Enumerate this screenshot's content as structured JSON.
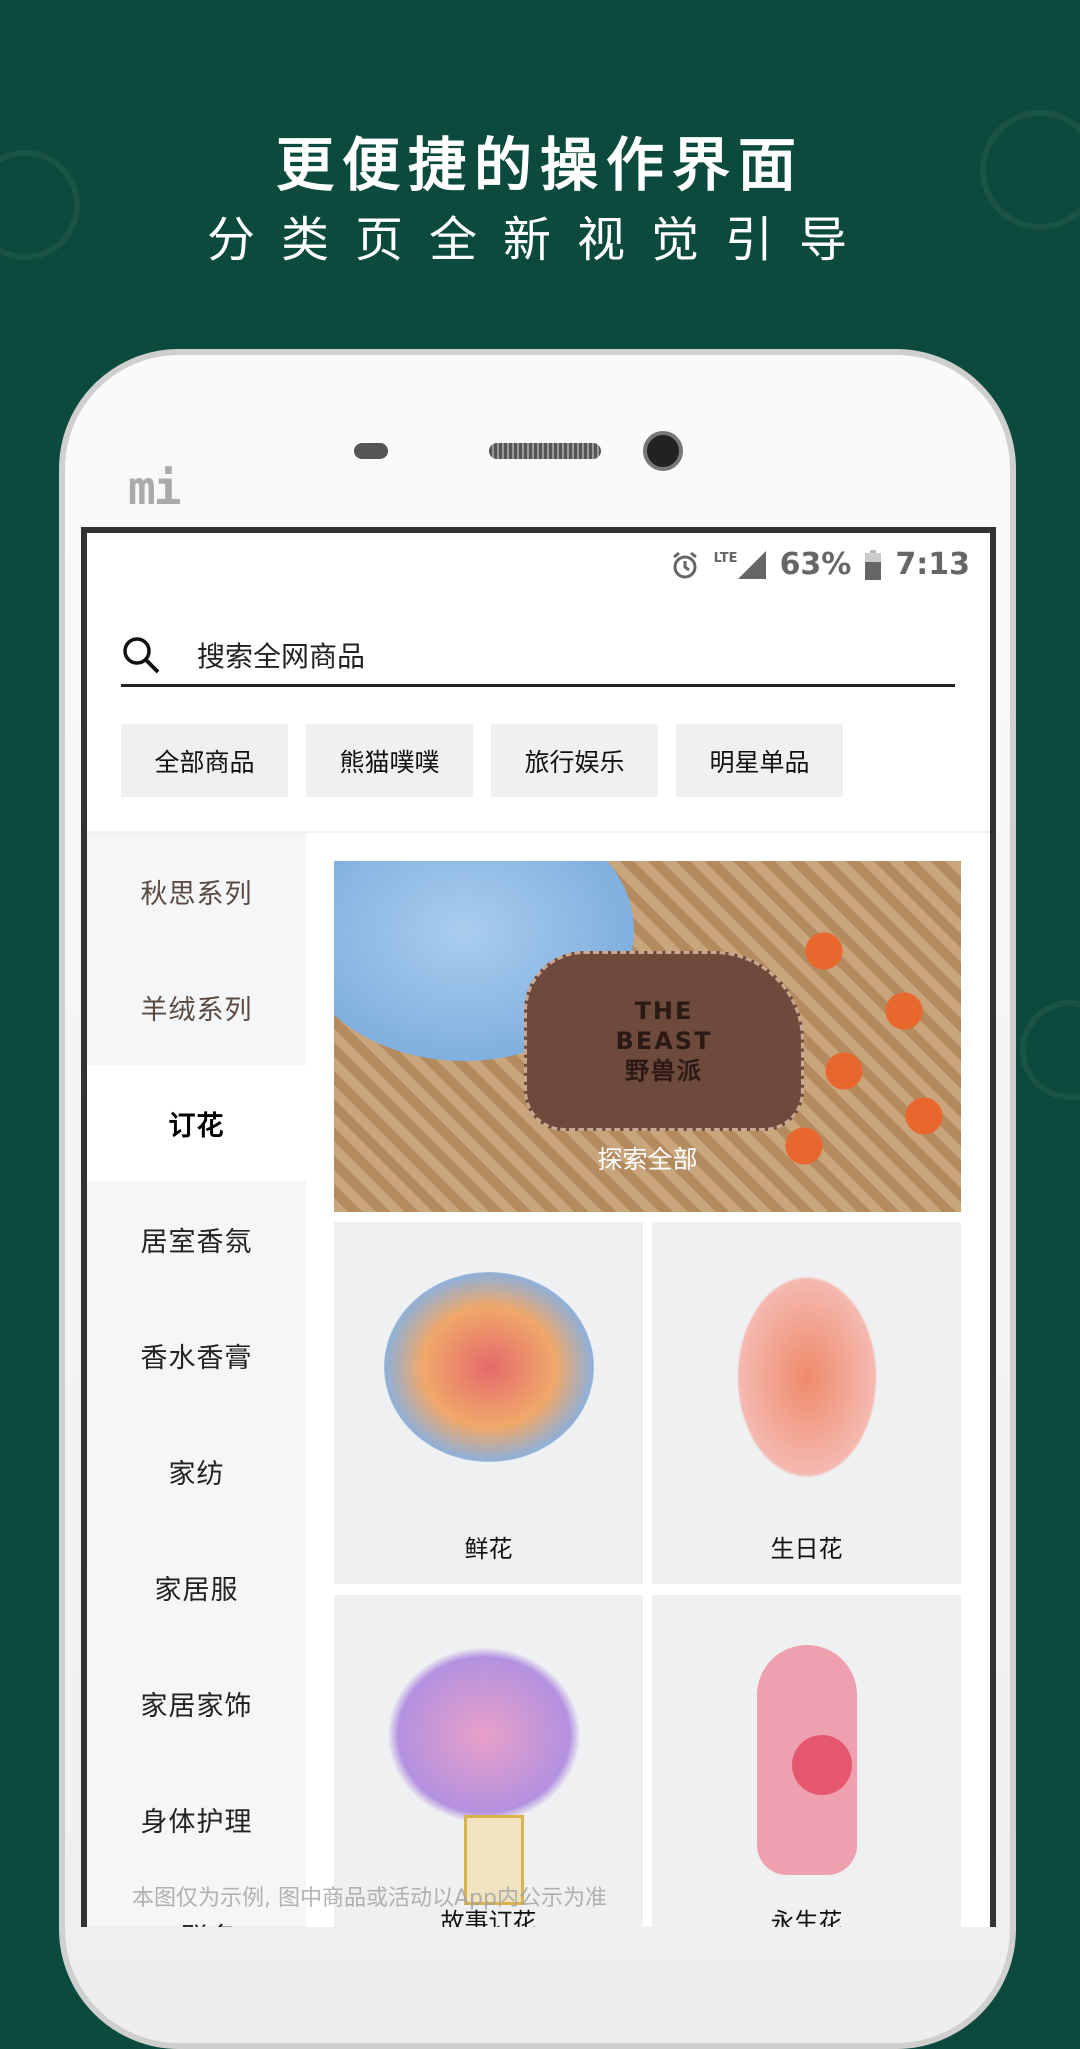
{
  "headline": {
    "title": "更便捷的操作界面",
    "subtitle": "分类页全新视觉引导"
  },
  "phone": {
    "brand_logo": "mi"
  },
  "status_bar": {
    "alarm_icon": "alarm-icon",
    "network": "LTE",
    "battery": "63%",
    "time": "7:13"
  },
  "search": {
    "placeholder": "搜索全网商品",
    "icon": "search-icon"
  },
  "chips": [
    "全部商品",
    "熊猫噗噗",
    "旅行娱乐",
    "明星单品"
  ],
  "sidebar": {
    "items": [
      "秋思系列",
      "羊绒系列",
      "订花",
      "居室香氛",
      "香水香膏",
      "家纺",
      "家居服",
      "家居家饰",
      "身体护理",
      "IP联名"
    ],
    "selected": "订花"
  },
  "banner": {
    "label": "探索全部",
    "brand": "THE BEAST 野兽派"
  },
  "grid": [
    "鲜花",
    "生日花",
    "故事订花",
    "永生花"
  ],
  "disclaimer": "本图仅为示例, 图中商品或活动以App内公示为准",
  "colors": {
    "background": "#0b4a3c",
    "chip_bg": "#eff0f2",
    "sidebar_bg": "#f5f6f8"
  }
}
